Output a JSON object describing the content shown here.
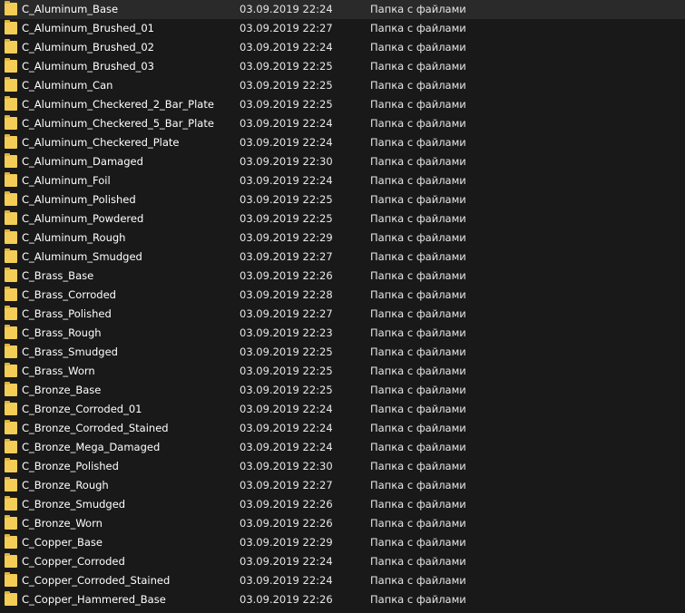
{
  "colors": {
    "background": "#191919",
    "text": "#ffffff",
    "folder": "#f4cd57"
  },
  "files": [
    {
      "name": "C_Aluminum_Base",
      "date": "03.09.2019 22:24",
      "type": "Папка с файлами",
      "icon": "folder-icon"
    },
    {
      "name": "C_Aluminum_Brushed_01",
      "date": "03.09.2019 22:27",
      "type": "Папка с файлами",
      "icon": "folder-icon"
    },
    {
      "name": "C_Aluminum_Brushed_02",
      "date": "03.09.2019 22:24",
      "type": "Папка с файлами",
      "icon": "folder-icon"
    },
    {
      "name": "C_Aluminum_Brushed_03",
      "date": "03.09.2019 22:25",
      "type": "Папка с файлами",
      "icon": "folder-icon"
    },
    {
      "name": "C_Aluminum_Can",
      "date": "03.09.2019 22:25",
      "type": "Папка с файлами",
      "icon": "folder-icon"
    },
    {
      "name": "C_Aluminum_Checkered_2_Bar_Plate",
      "date": "03.09.2019 22:25",
      "type": "Папка с файлами",
      "icon": "folder-icon"
    },
    {
      "name": "C_Aluminum_Checkered_5_Bar_Plate",
      "date": "03.09.2019 22:24",
      "type": "Папка с файлами",
      "icon": "folder-icon"
    },
    {
      "name": "C_Aluminum_Checkered_Plate",
      "date": "03.09.2019 22:24",
      "type": "Папка с файлами",
      "icon": "folder-icon"
    },
    {
      "name": "C_Aluminum_Damaged",
      "date": "03.09.2019 22:30",
      "type": "Папка с файлами",
      "icon": "folder-icon"
    },
    {
      "name": "C_Aluminum_Foil",
      "date": "03.09.2019 22:24",
      "type": "Папка с файлами",
      "icon": "folder-icon"
    },
    {
      "name": "C_Aluminum_Polished",
      "date": "03.09.2019 22:25",
      "type": "Папка с файлами",
      "icon": "folder-icon"
    },
    {
      "name": "C_Aluminum_Powdered",
      "date": "03.09.2019 22:25",
      "type": "Папка с файлами",
      "icon": "folder-icon"
    },
    {
      "name": "C_Aluminum_Rough",
      "date": "03.09.2019 22:29",
      "type": "Папка с файлами",
      "icon": "folder-icon"
    },
    {
      "name": "C_Aluminum_Smudged",
      "date": "03.09.2019 22:27",
      "type": "Папка с файлами",
      "icon": "folder-icon"
    },
    {
      "name": "C_Brass_Base",
      "date": "03.09.2019 22:26",
      "type": "Папка с файлами",
      "icon": "folder-icon"
    },
    {
      "name": "C_Brass_Corroded",
      "date": "03.09.2019 22:28",
      "type": "Папка с файлами",
      "icon": "folder-icon"
    },
    {
      "name": "C_Brass_Polished",
      "date": "03.09.2019 22:27",
      "type": "Папка с файлами",
      "icon": "folder-icon"
    },
    {
      "name": "C_Brass_Rough",
      "date": "03.09.2019 22:23",
      "type": "Папка с файлами",
      "icon": "folder-icon"
    },
    {
      "name": "C_Brass_Smudged",
      "date": "03.09.2019 22:25",
      "type": "Папка с файлами",
      "icon": "folder-icon"
    },
    {
      "name": "C_Brass_Worn",
      "date": "03.09.2019 22:25",
      "type": "Папка с файлами",
      "icon": "folder-icon"
    },
    {
      "name": "C_Bronze_Base",
      "date": "03.09.2019 22:25",
      "type": "Папка с файлами",
      "icon": "folder-icon"
    },
    {
      "name": "C_Bronze_Corroded_01",
      "date": "03.09.2019 22:24",
      "type": "Папка с файлами",
      "icon": "folder-icon"
    },
    {
      "name": "C_Bronze_Corroded_Stained",
      "date": "03.09.2019 22:24",
      "type": "Папка с файлами",
      "icon": "folder-icon"
    },
    {
      "name": "C_Bronze_Mega_Damaged",
      "date": "03.09.2019 22:24",
      "type": "Папка с файлами",
      "icon": "folder-icon"
    },
    {
      "name": "C_Bronze_Polished",
      "date": "03.09.2019 22:30",
      "type": "Папка с файлами",
      "icon": "folder-icon"
    },
    {
      "name": "C_Bronze_Rough",
      "date": "03.09.2019 22:27",
      "type": "Папка с файлами",
      "icon": "folder-icon"
    },
    {
      "name": "C_Bronze_Smudged",
      "date": "03.09.2019 22:26",
      "type": "Папка с файлами",
      "icon": "folder-icon"
    },
    {
      "name": "C_Bronze_Worn",
      "date": "03.09.2019 22:26",
      "type": "Папка с файлами",
      "icon": "folder-icon"
    },
    {
      "name": "C_Copper_Base",
      "date": "03.09.2019 22:29",
      "type": "Папка с файлами",
      "icon": "folder-icon"
    },
    {
      "name": "C_Copper_Corroded",
      "date": "03.09.2019 22:24",
      "type": "Папка с файлами",
      "icon": "folder-icon"
    },
    {
      "name": "C_Copper_Corroded_Stained",
      "date": "03.09.2019 22:24",
      "type": "Папка с файлами",
      "icon": "folder-icon"
    },
    {
      "name": "C_Copper_Hammered_Base",
      "date": "03.09.2019 22:26",
      "type": "Папка с файлами",
      "icon": "folder-icon"
    }
  ]
}
